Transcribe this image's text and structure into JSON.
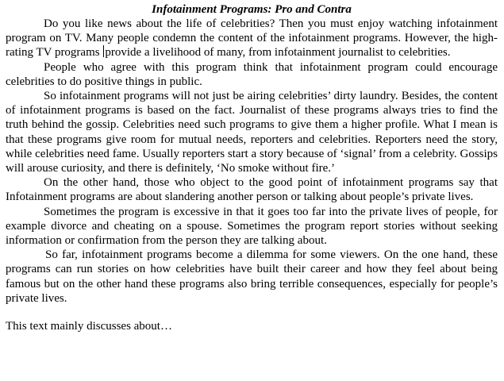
{
  "document": {
    "title": "Infotainment Programs: Pro and Contra",
    "paragraphs": [
      "Do you like news about the life of celebrities? Then you must enjoy watching infotainment program on TV. Many people condemn the content of the infotainment programs. However, the high-rating TV programs provide a livelihood of many, from infotainment journalist to celebrities.",
      "People who agree with this program think that infotainment program could encourage celebrities to do positive things in public.",
      "So infotainment programs will not just be airing celebrities’ dirty laundry. Besides, the content of infotainment programs is based on the fact. Journalist of these programs always tries to find the truth behind the gossip. Celebrities need such programs to give them a higher profile. What I mean is that these programs give room for mutual needs, reporters and celebrities. Reporters need the story, while celebrities need fame. Usually reporters start a story because of ‘signal’ from a celebrity. Gossips will arouse curiosity, and there is definitely, ‘No smoke without fire.’",
      "On the other hand, those who object to the good point of infotainment programs say that Infotainment programs are about slandering another person or talking about people’s private lives.",
      "Sometimes the program is excessive in that it goes too far into the private lives of people, for example divorce and cheating on a spouse. Sometimes the program report stories without seeking information or confirmation from the person they are talking about.",
      "So far, infotainment programs become a dilemma for some viewers. On the one hand, these programs can run stories on how celebrities have built their career and how they feel about being famous but on the other hand these programs also bring terrible consequences, especially for people’s private lives."
    ],
    "question": "This text mainly discusses about…"
  }
}
